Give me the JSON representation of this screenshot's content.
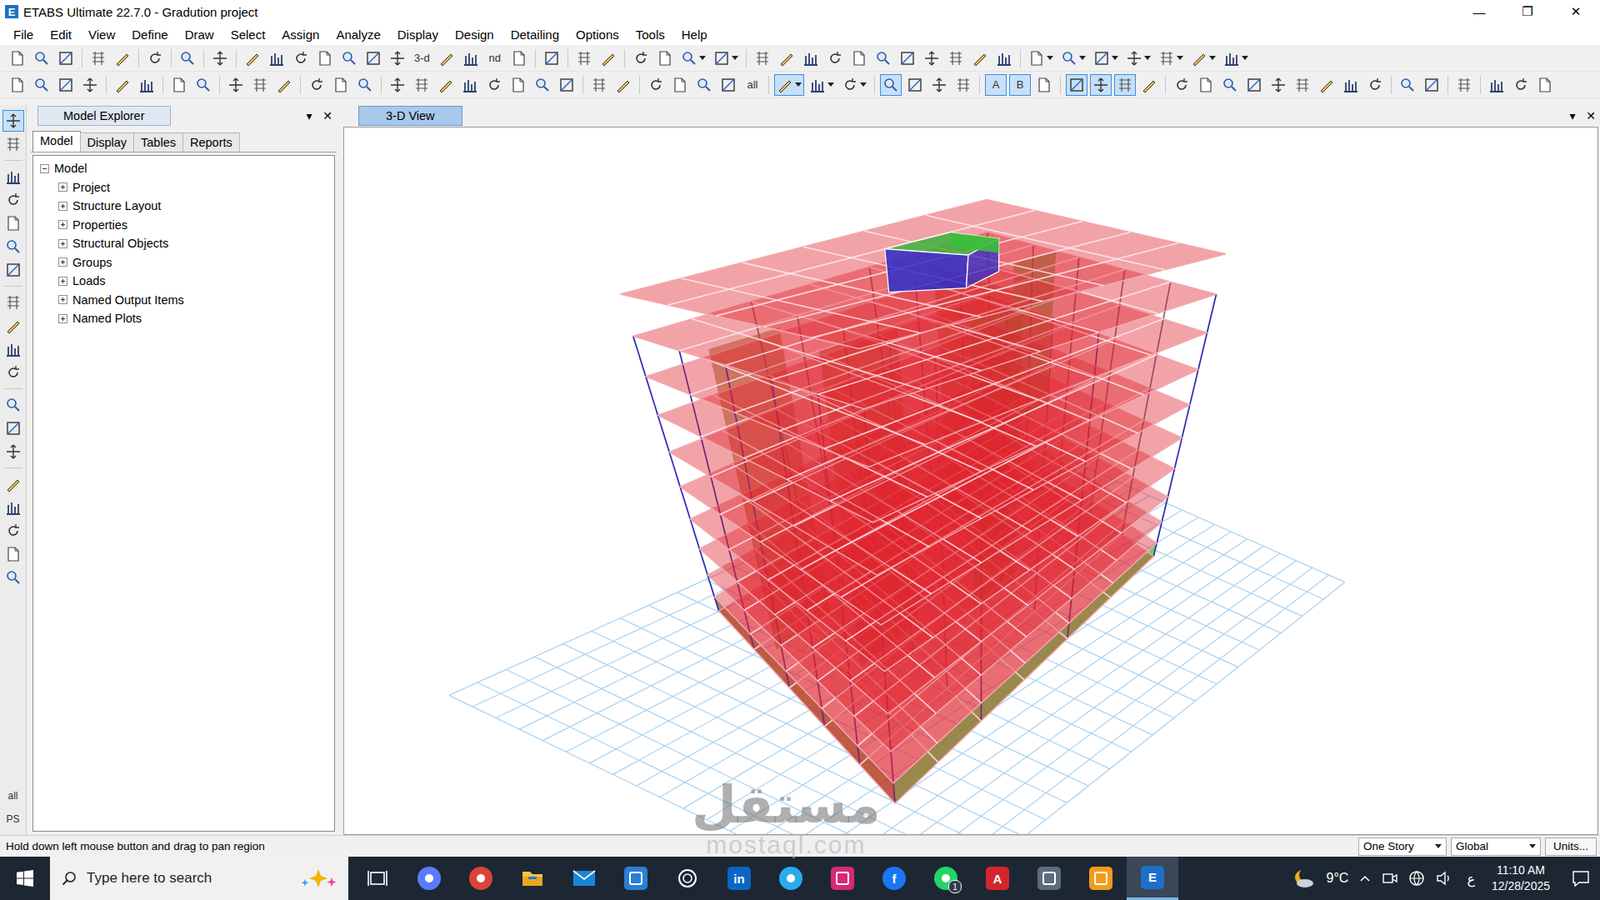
{
  "window": {
    "title": "ETABS Ultimate 22.7.0 - Gradution project",
    "app_icon": "E",
    "controls": [
      "—",
      "❐",
      "✕"
    ]
  },
  "menu": [
    "File",
    "Edit",
    "View",
    "Define",
    "Draw",
    "Select",
    "Assign",
    "Analyze",
    "Display",
    "Design",
    "Detailing",
    "Options",
    "Tools",
    "Help"
  ],
  "toolbars": [
    [
      {
        "kind": "icon",
        "selected": false
      },
      {
        "kind": "icon",
        "selected": false
      },
      {
        "kind": "icon",
        "selected": false
      },
      {
        "kind": "sep"
      },
      {
        "kind": "icon",
        "selected": false
      },
      {
        "kind": "icon",
        "selected": false
      },
      {
        "kind": "sep"
      },
      {
        "kind": "icon",
        "selected": false
      },
      {
        "kind": "sep"
      },
      {
        "kind": "icon",
        "selected": false
      },
      {
        "kind": "sep"
      },
      {
        "kind": "icon",
        "selected": false
      },
      {
        "kind": "sep"
      },
      {
        "kind": "icon",
        "selected": false
      },
      {
        "kind": "icon",
        "selected": false
      },
      {
        "kind": "icon",
        "selected": false
      },
      {
        "kind": "icon",
        "selected": false
      },
      {
        "kind": "icon",
        "selected": false
      },
      {
        "kind": "icon",
        "selected": false
      },
      {
        "kind": "icon",
        "selected": false
      },
      {
        "kind": "text",
        "label": "3-d",
        "selected": false
      },
      {
        "kind": "icon",
        "selected": false
      },
      {
        "kind": "icon",
        "selected": false
      },
      {
        "kind": "text",
        "label": "nd",
        "selected": false
      },
      {
        "kind": "icon",
        "selected": false
      },
      {
        "kind": "sep"
      },
      {
        "kind": "icon",
        "selected": false
      },
      {
        "kind": "sep"
      },
      {
        "kind": "icon",
        "selected": false
      },
      {
        "kind": "icon",
        "selected": false
      },
      {
        "kind": "sep"
      },
      {
        "kind": "icon",
        "selected": false
      },
      {
        "kind": "icon",
        "selected": false
      },
      {
        "kind": "dropdown",
        "selected": false
      },
      {
        "kind": "dropdown",
        "selected": false
      },
      {
        "kind": "sep"
      },
      {
        "kind": "icon",
        "selected": false
      },
      {
        "kind": "icon",
        "selected": false
      },
      {
        "kind": "icon",
        "selected": false
      },
      {
        "kind": "icon",
        "selected": false
      },
      {
        "kind": "icon",
        "selected": false
      },
      {
        "kind": "icon",
        "selected": false
      },
      {
        "kind": "icon",
        "selected": false
      },
      {
        "kind": "icon",
        "selected": false
      },
      {
        "kind": "icon",
        "selected": false
      },
      {
        "kind": "icon",
        "selected": false
      },
      {
        "kind": "icon",
        "selected": false
      },
      {
        "kind": "sep"
      },
      {
        "kind": "dropdown",
        "selected": false
      },
      {
        "kind": "dropdown",
        "selected": false
      },
      {
        "kind": "dropdown",
        "selected": false
      },
      {
        "kind": "dropdown",
        "selected": false
      },
      {
        "kind": "dropdown",
        "selected": false
      },
      {
        "kind": "dropdown",
        "selected": false
      },
      {
        "kind": "dropdown",
        "selected": false
      }
    ],
    [
      {
        "kind": "icon",
        "selected": false
      },
      {
        "kind": "icon",
        "selected": false
      },
      {
        "kind": "icon",
        "selected": false
      },
      {
        "kind": "icon",
        "selected": false
      },
      {
        "kind": "sep"
      },
      {
        "kind": "icon",
        "selected": false
      },
      {
        "kind": "icon",
        "selected": false
      },
      {
        "kind": "sep"
      },
      {
        "kind": "icon",
        "selected": false
      },
      {
        "kind": "icon",
        "selected": false
      },
      {
        "kind": "sep"
      },
      {
        "kind": "icon",
        "selected": false
      },
      {
        "kind": "icon",
        "selected": false
      },
      {
        "kind": "icon",
        "selected": false
      },
      {
        "kind": "sep"
      },
      {
        "kind": "icon",
        "selected": false
      },
      {
        "kind": "icon",
        "selected": false
      },
      {
        "kind": "icon",
        "selected": false
      },
      {
        "kind": "sep"
      },
      {
        "kind": "icon",
        "selected": false
      },
      {
        "kind": "icon",
        "selected": false
      },
      {
        "kind": "icon",
        "selected": false
      },
      {
        "kind": "icon",
        "selected": false
      },
      {
        "kind": "icon",
        "selected": false
      },
      {
        "kind": "icon",
        "selected": false
      },
      {
        "kind": "icon",
        "selected": false
      },
      {
        "kind": "icon",
        "selected": false
      },
      {
        "kind": "sep"
      },
      {
        "kind": "icon",
        "selected": false
      },
      {
        "kind": "icon",
        "selected": false
      },
      {
        "kind": "sep"
      },
      {
        "kind": "icon",
        "selected": false
      },
      {
        "kind": "icon",
        "selected": false
      },
      {
        "kind": "icon",
        "selected": false
      },
      {
        "kind": "icon",
        "selected": false
      },
      {
        "kind": "text",
        "label": "all",
        "selected": false
      },
      {
        "kind": "sep"
      },
      {
        "kind": "dropdown",
        "selected": true
      },
      {
        "kind": "dropdown",
        "selected": false
      },
      {
        "kind": "dropdown",
        "selected": false
      },
      {
        "kind": "sep"
      },
      {
        "kind": "icon",
        "selected": true
      },
      {
        "kind": "icon",
        "selected": false
      },
      {
        "kind": "icon",
        "selected": false
      },
      {
        "kind": "icon",
        "selected": false
      },
      {
        "kind": "sep"
      },
      {
        "kind": "text",
        "label": "A",
        "selected": true
      },
      {
        "kind": "text",
        "label": "B",
        "selected": true
      },
      {
        "kind": "icon",
        "selected": false
      },
      {
        "kind": "sep"
      },
      {
        "kind": "icon",
        "selected": true
      },
      {
        "kind": "icon",
        "selected": true
      },
      {
        "kind": "icon",
        "selected": true
      },
      {
        "kind": "icon",
        "selected": false
      },
      {
        "kind": "sep"
      },
      {
        "kind": "icon",
        "selected": false
      },
      {
        "kind": "icon",
        "selected": false
      },
      {
        "kind": "icon",
        "selected": false
      },
      {
        "kind": "icon",
        "selected": false
      },
      {
        "kind": "icon",
        "selected": false
      },
      {
        "kind": "icon",
        "selected": false
      },
      {
        "kind": "icon",
        "selected": false
      },
      {
        "kind": "icon",
        "selected": false
      },
      {
        "kind": "icon",
        "selected": false
      },
      {
        "kind": "sep"
      },
      {
        "kind": "icon",
        "selected": false
      },
      {
        "kind": "icon",
        "selected": false
      },
      {
        "kind": "sep"
      },
      {
        "kind": "icon",
        "selected": false
      },
      {
        "kind": "sep"
      },
      {
        "kind": "icon",
        "selected": false
      },
      {
        "kind": "icon",
        "selected": false
      },
      {
        "kind": "icon",
        "selected": false
      }
    ]
  ],
  "side_toolbar": [
    {
      "kind": "icon",
      "selected": true
    },
    {
      "kind": "icon",
      "selected": false
    },
    {
      "kind": "sep"
    },
    {
      "kind": "icon",
      "selected": false
    },
    {
      "kind": "icon",
      "selected": false
    },
    {
      "kind": "icon",
      "selected": false
    },
    {
      "kind": "icon",
      "selected": false
    },
    {
      "kind": "icon",
      "selected": false
    },
    {
      "kind": "sep"
    },
    {
      "kind": "icon",
      "selected": false
    },
    {
      "kind": "icon",
      "selected": false
    },
    {
      "kind": "icon",
      "selected": false
    },
    {
      "kind": "icon",
      "selected": false
    },
    {
      "kind": "sep"
    },
    {
      "kind": "icon",
      "selected": false
    },
    {
      "kind": "icon",
      "selected": false
    },
    {
      "kind": "icon",
      "selected": false
    },
    {
      "kind": "sep"
    },
    {
      "kind": "icon",
      "selected": false
    },
    {
      "kind": "icon",
      "selected": false
    },
    {
      "kind": "icon",
      "selected": false
    },
    {
      "kind": "icon",
      "selected": false
    },
    {
      "kind": "icon",
      "selected": false
    },
    {
      "kind": "spacer"
    },
    {
      "kind": "text",
      "label": "all",
      "selected": false
    },
    {
      "kind": "text",
      "label": "PS",
      "selected": false
    }
  ],
  "explorer": {
    "title": "Model Explorer",
    "pin": "▾",
    "close": "✕",
    "tabs": [
      {
        "label": "Model",
        "selected": true
      },
      {
        "label": "Display",
        "selected": false
      },
      {
        "label": "Tables",
        "selected": false
      },
      {
        "label": "Reports",
        "selected": false
      }
    ],
    "tree": {
      "label": "Model",
      "expanded": true,
      "children": [
        {
          "label": "Project",
          "expanded": false
        },
        {
          "label": "Structure Layout",
          "expanded": false
        },
        {
          "label": "Properties",
          "expanded": false
        },
        {
          "label": "Structural Objects",
          "expanded": false
        },
        {
          "label": "Groups",
          "expanded": false
        },
        {
          "label": "Loads",
          "expanded": false
        },
        {
          "label": "Named Output Items",
          "expanded": false
        },
        {
          "label": "Named Plots",
          "expanded": false
        }
      ]
    }
  },
  "view": {
    "tab": {
      "label": "3-D View",
      "selected": true
    },
    "pin": "▾",
    "close": "✕",
    "model": {
      "stories": 11
    }
  },
  "status_bar": {
    "message": "Hold down left mouse button and drag to pan region",
    "story_filter": "One Story",
    "coord_system": "Global",
    "units_button": "Units..."
  },
  "taskbar": {
    "search_placeholder": "Type here to search",
    "apps": [
      {
        "kind": "taskview",
        "color": "#ffffff",
        "active": false
      },
      {
        "kind": "circle",
        "color": "#5b7cf7",
        "active": false
      },
      {
        "kind": "circle",
        "color": "#db4437",
        "active": false
      },
      {
        "kind": "folder",
        "color": "#f4c542",
        "active": false
      },
      {
        "kind": "envelope",
        "color": "#1a86d9",
        "active": false
      },
      {
        "kind": "tile",
        "color": "#2a7fd4",
        "active": false
      },
      {
        "kind": "ring",
        "color": "#ffffff",
        "active": false
      },
      {
        "kind": "tile",
        "color": "#0a66c2",
        "glyph": "in",
        "active": false
      },
      {
        "kind": "circle",
        "color": "#2aabee",
        "active": false
      },
      {
        "kind": "tile",
        "color": "#d62976",
        "active": false
      },
      {
        "kind": "circle",
        "color": "#1877f2",
        "glyph": "f",
        "active": false
      },
      {
        "kind": "circle",
        "color": "#25d366",
        "badge": "1",
        "active": false
      },
      {
        "kind": "tile",
        "color": "#d4252c",
        "glyph": "A",
        "active": false
      },
      {
        "kind": "tile",
        "color": "#5d6b7c",
        "active": false
      },
      {
        "kind": "tile",
        "color": "#f39a1e",
        "active": false
      },
      {
        "kind": "tile",
        "color": "#1e6fc9",
        "glyph": "E",
        "active": true
      }
    ],
    "weather": "9°C",
    "language": "ع",
    "time": "11:10 AM",
    "date": "12/28/2025"
  },
  "watermark": {
    "arabic": "مستقل",
    "latin": "mostaql.com"
  }
}
